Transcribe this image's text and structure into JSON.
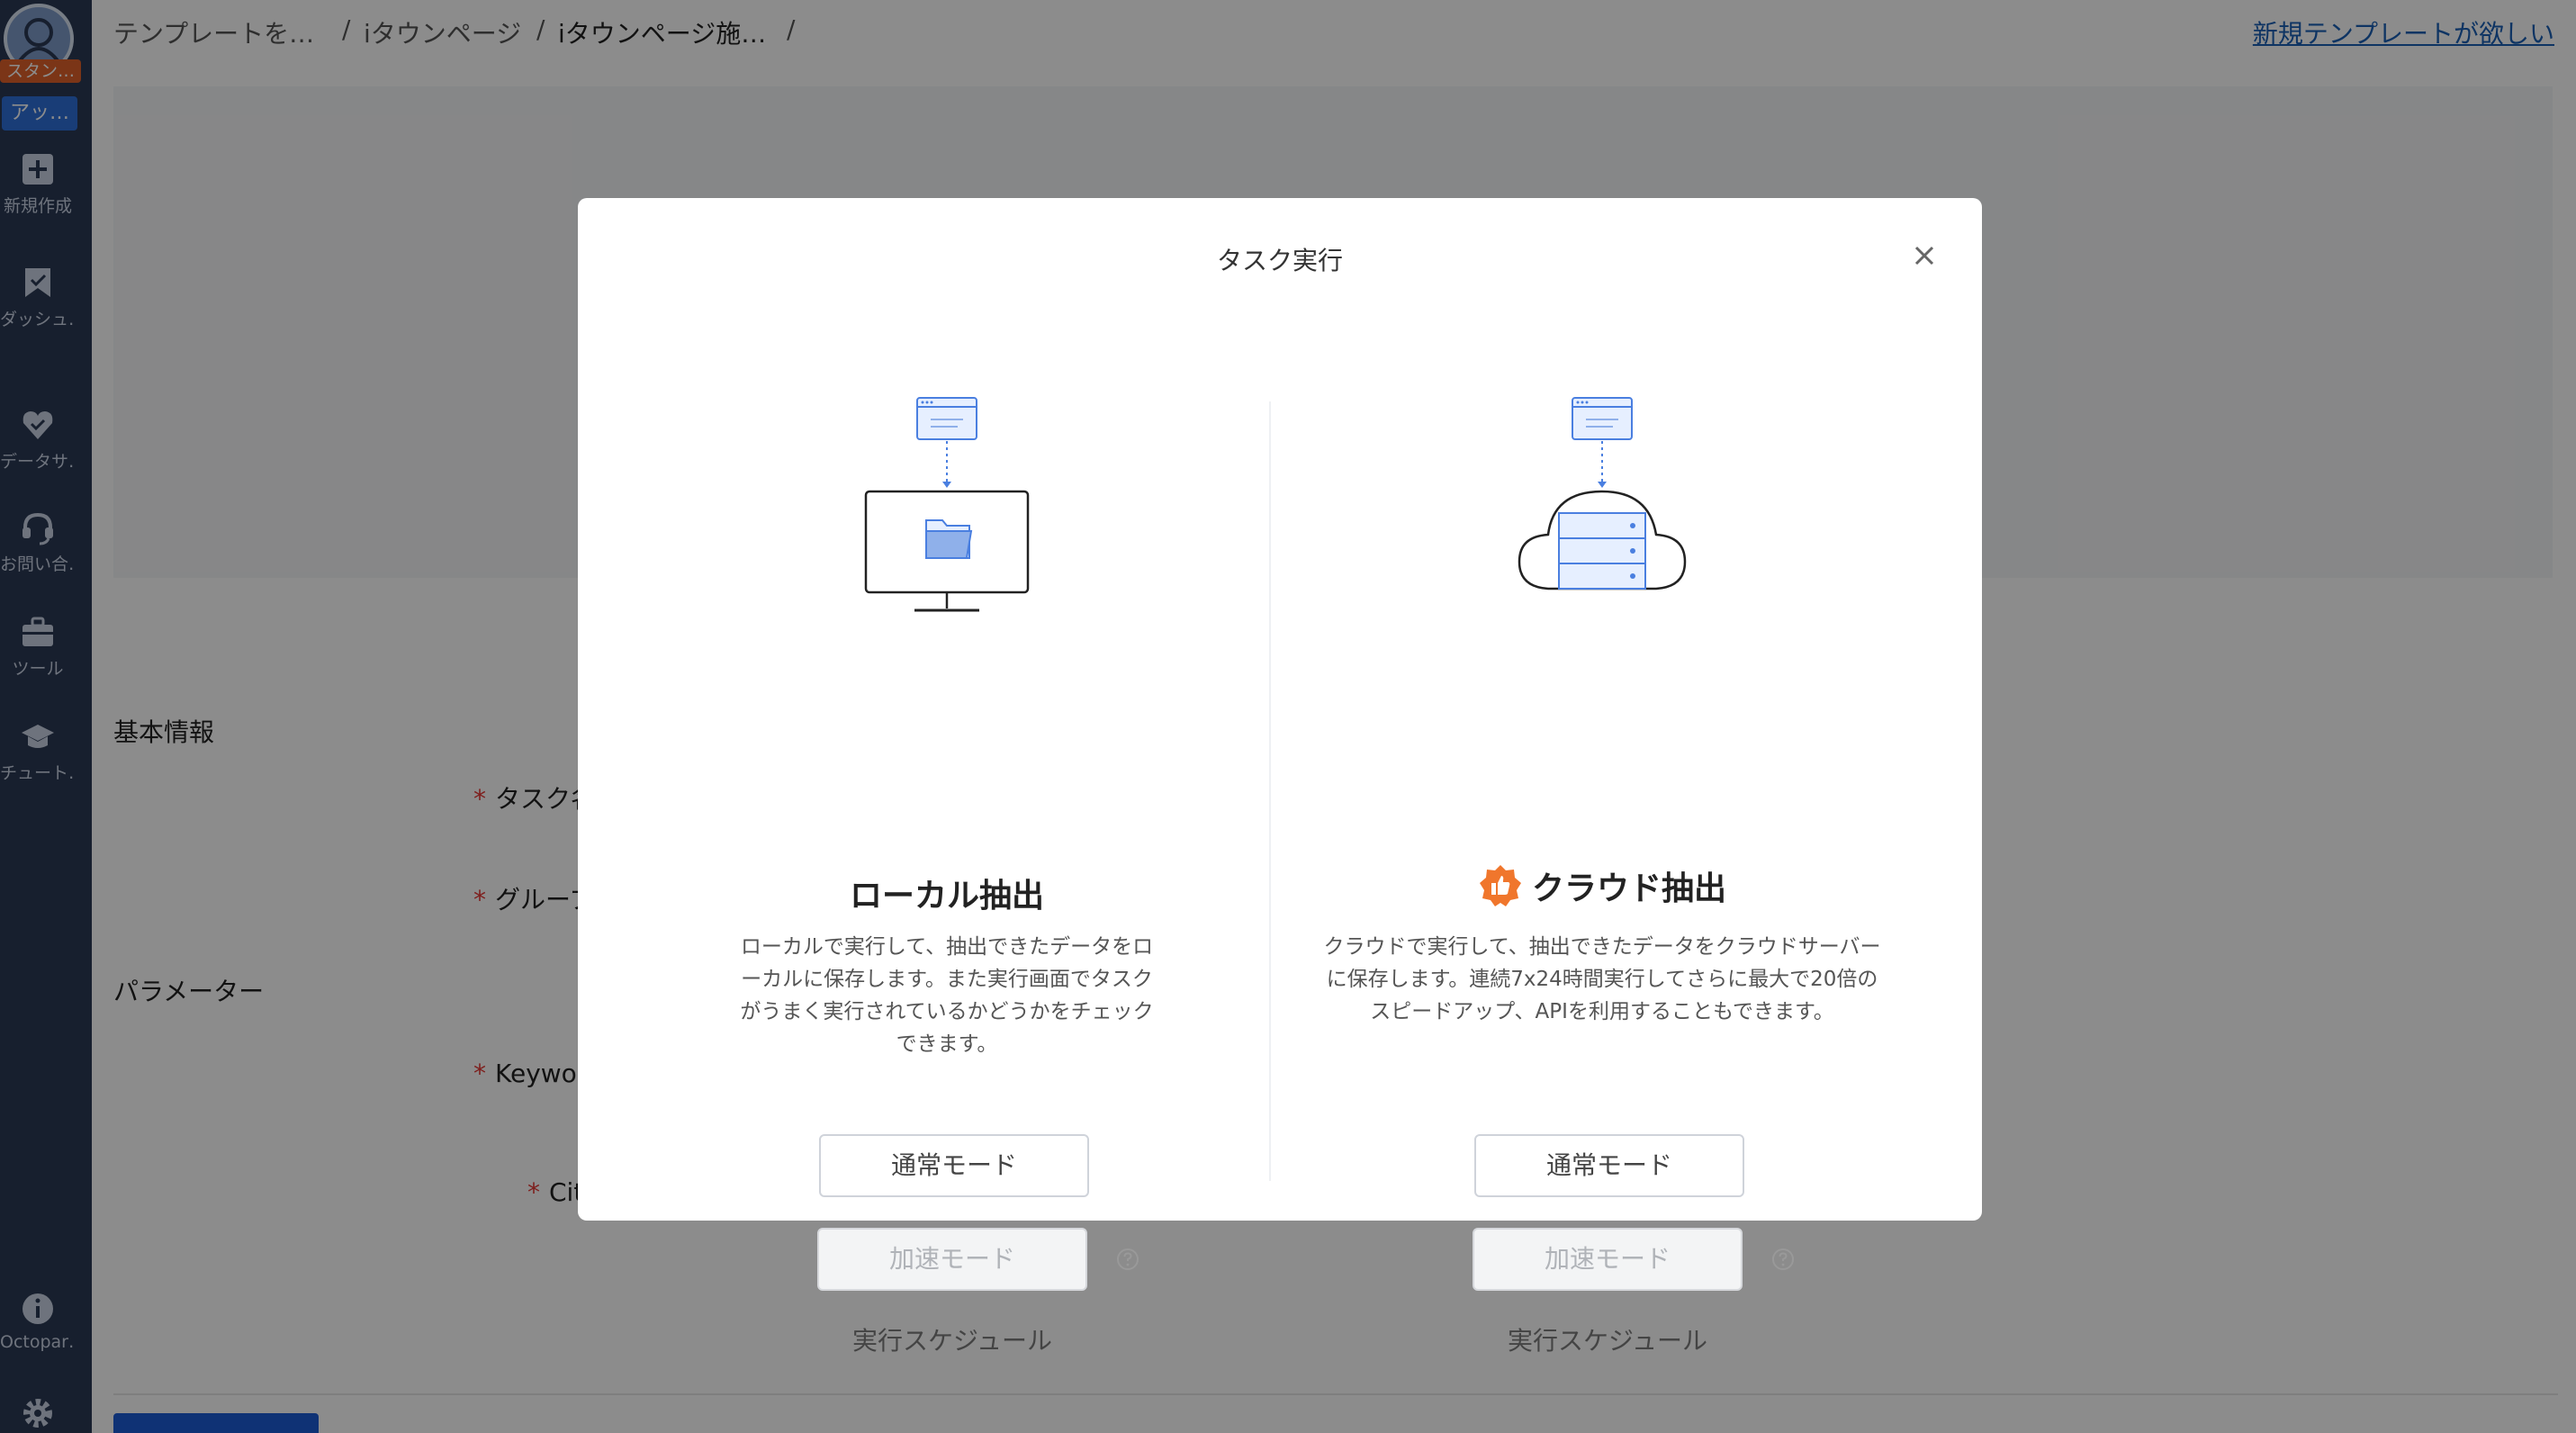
{
  "sidebar": {
    "logo_badge": "スタン…",
    "app_badge": "アッ…",
    "items": [
      {
        "label": "新規作成",
        "icon": "plus-square-icon"
      },
      {
        "label": "ダッシュ…",
        "icon": "bookmark-icon"
      },
      {
        "label": "データサ…",
        "icon": "heart-check-icon"
      },
      {
        "label": "お問い合…",
        "icon": "headset-icon"
      },
      {
        "label": "ツール",
        "icon": "toolbox-icon"
      },
      {
        "label": "チュート…",
        "icon": "graduation-cap-icon"
      },
      {
        "label": "Octopar…",
        "icon": "info-icon"
      }
    ]
  },
  "breadcrumb": {
    "items": [
      "テンプレートを…",
      "iタウンページ",
      "iタウンページ施…"
    ],
    "sep": "/"
  },
  "request_template_link": "新規テンプレートが欲しい",
  "form": {
    "basic_info": "基本情報",
    "task_label": "タスク名",
    "group_label": "グループ",
    "parameters": "パラメーター",
    "keyword_label": "Keyword",
    "city_label": "City"
  },
  "modal": {
    "title": "タスク実行",
    "local": {
      "title": "ローカル抽出",
      "description": "ローカルで実行して、抽出できたデータをローカルに保存します。また実行画面でタスクがうまく実行されているかどうかをチェックできます。",
      "normal_mode": "通常モード",
      "fast_mode": "加速モード",
      "schedule": "実行スケジュール"
    },
    "cloud": {
      "title": "クラウド抽出",
      "badge_icon": "thumbs-up-badge-icon",
      "description": "クラウドで実行して、抽出できたデータをクラウドサーバーに保存します。連続7x24時間実行してさらに最大で20倍のスピードアップ、APIを利用することもできます。",
      "normal_mode": "通常モード",
      "fast_mode": "加速モード",
      "schedule": "実行スケジュール"
    }
  },
  "colors": {
    "sidebar_bg": "#2b3a55",
    "accent_blue": "#1d5bd6",
    "logo_orange": "#e0622a",
    "badge_orange": "#f0762c"
  }
}
